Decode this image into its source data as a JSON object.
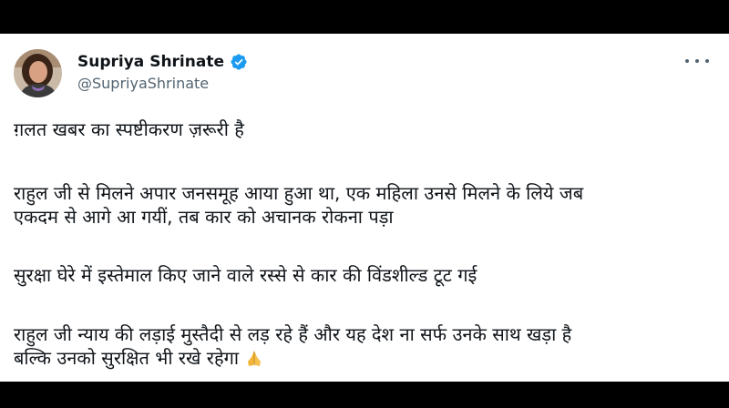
{
  "tweet": {
    "author": {
      "display_name": "Supriya Shrinate",
      "handle": "@SupriyaShrinate",
      "verified": true
    },
    "paragraphs": [
      [
        "ग़लत खबर का स्पष्टीकरण ज़रूरी है"
      ],
      [
        "राहुल जी से मिलने अपार जनसमूह आया हुआ था, एक महिला उनसे मिलने के लिये जब",
        "एकदम से आगे आ गयीं, तब कार को अचानक रोकना पड़ा"
      ],
      [
        "सुरक्षा घेरे में इस्तेमाल किए जाने वाले रस्से से कार की विंडशील्ड टूट गई"
      ],
      [
        "राहुल जी न्याय की लड़ाई मुस्तैदी से लड़ रहे हैं और यह देश ना सर्फ उनके साथ खड़ा है",
        "बल्कि उनको सुरक्षित भी रखे रहेगा"
      ]
    ],
    "trailing_emoji": "folded-hands-emoji"
  },
  "icons": {
    "verified": "verified-badge-icon",
    "more": "more-options-icon"
  },
  "colors": {
    "background": "#000000",
    "card": "#ffffff",
    "text_primary": "#0f1419",
    "text_secondary": "#536471",
    "verified_blue": "#1d9bf0"
  }
}
